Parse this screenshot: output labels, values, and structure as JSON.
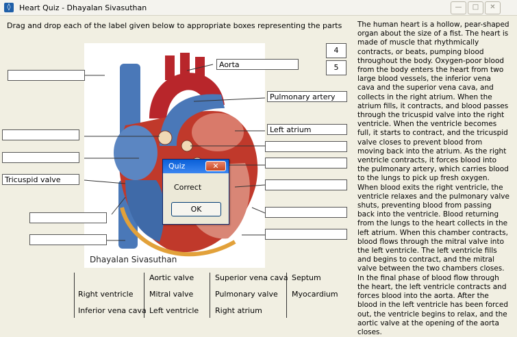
{
  "window": {
    "title": "Heart Quiz - Dhayalan Sivasuthan",
    "minimize": "—",
    "maximize": "□",
    "close": "✕"
  },
  "instruction": "Drag and drop each of the label given below to appropriate boxes representing the parts",
  "pager": [
    "4",
    "5"
  ],
  "answer_boxes": {
    "aorta": "Aorta",
    "pulmonary_artery": "Pulmonary artery",
    "left_atrium": "Left atrium",
    "tricuspid_valve": "Tricuspid valve"
  },
  "watermark": "Dhayalan Sivasuthan",
  "description": "The human heart is a hollow, pear-shaped organ about the size of a fist. The heart is made of muscle that rhythmically contracts, or beats, pumping blood throughout the body. Oxygen-poor blood from the body enters the heart from two large blood vessels, the inferior vena cava and the superior vena cava, and collects in the right atrium. When the atrium fills, it contracts, and blood passes through the tricuspid valve into the right ventricle. When the ventricle becomes full, it starts to contract, and the tricuspid valve closes to prevent blood from moving back into the atrium. As the right ventricle contracts, it forces blood into the pulmonary artery, which carries blood to the lungs to pick up fresh oxygen. When blood exits the right ventricle, the ventricle relaxes and the pulmonary valve shuts, preventing blood from passing back into the ventricle. Blood returning from the lungs to the heart collects in the left atrium. When this chamber contracts, blood flows through the mitral valve into the left ventricle. The left ventricle fills and begins to contract, and the mitral valve between the two chambers closes. In the final phase of blood flow through the heart, the left ventricle contracts and forces blood into the aorta. After the blood in the left ventricle has been forced out, the ventricle begins to relax, and the aortic valve at the opening of the aorta closes.",
  "labels": {
    "right_ventricle": "Right ventricle",
    "inferior_vena_cava": "Inferior vena cava",
    "aortic_valve": "Aortic valve",
    "mitral_valve": "Mitral valve",
    "left_ventricle": "Left ventricle",
    "superior_vena_cava": "Superior vena cava",
    "pulmonary_valve": "Pulmonary valve",
    "right_atrium": "Right atrium",
    "septum": "Septum",
    "myocardium": "Myocardium"
  },
  "dialog": {
    "title": "Quiz",
    "close": "✕",
    "message": "Correct",
    "ok": "OK"
  }
}
